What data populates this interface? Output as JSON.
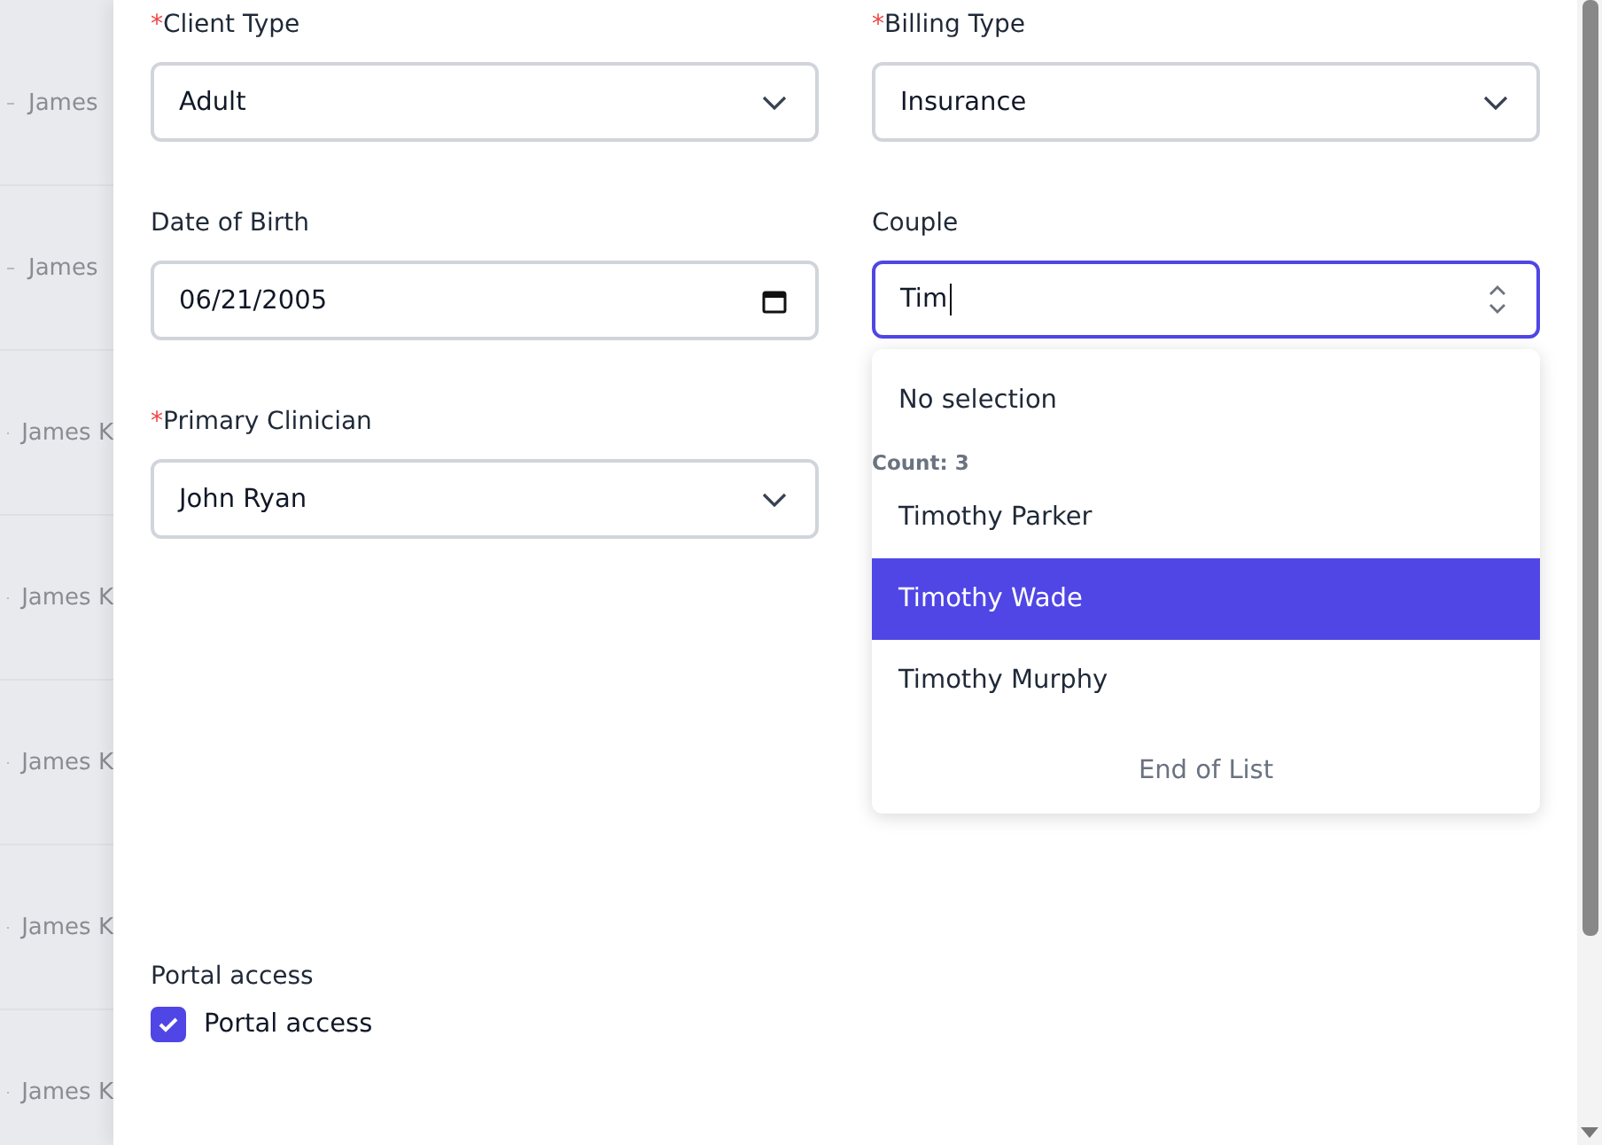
{
  "background_list": [
    {
      "name": "James"
    },
    {
      "name": "James"
    },
    {
      "name": "James K"
    },
    {
      "name": "James K"
    },
    {
      "name": "James K"
    },
    {
      "name": "James K"
    },
    {
      "name": "James K"
    }
  ],
  "form": {
    "fields": [
      {
        "label": "Client Type",
        "required_mark": "*",
        "kind": "select",
        "value": "Adult"
      },
      {
        "label": "Billing Type",
        "required_mark": "*",
        "kind": "select",
        "value": "Insurance"
      },
      {
        "label": "Date of Birth",
        "kind": "date",
        "value": "06/21/2005"
      },
      {
        "label": "Couple",
        "kind": "combobox",
        "value": "Tim",
        "focused": true
      },
      {
        "label": "Primary Clinician",
        "required_mark": "*",
        "kind": "select",
        "value": "John Ryan"
      }
    ],
    "dropdown": {
      "empty_option": "No selection",
      "count": "Count: 3",
      "options": [
        {
          "label": "Timothy Parker",
          "selected": false
        },
        {
          "label": "Timothy Wade",
          "selected": true
        },
        {
          "label": "Timothy Murphy",
          "selected": false
        }
      ],
      "footer": "End of List"
    },
    "portal": {
      "heading": "Portal access",
      "checkbox": {
        "label": "Portal access",
        "checked": true
      }
    }
  }
}
